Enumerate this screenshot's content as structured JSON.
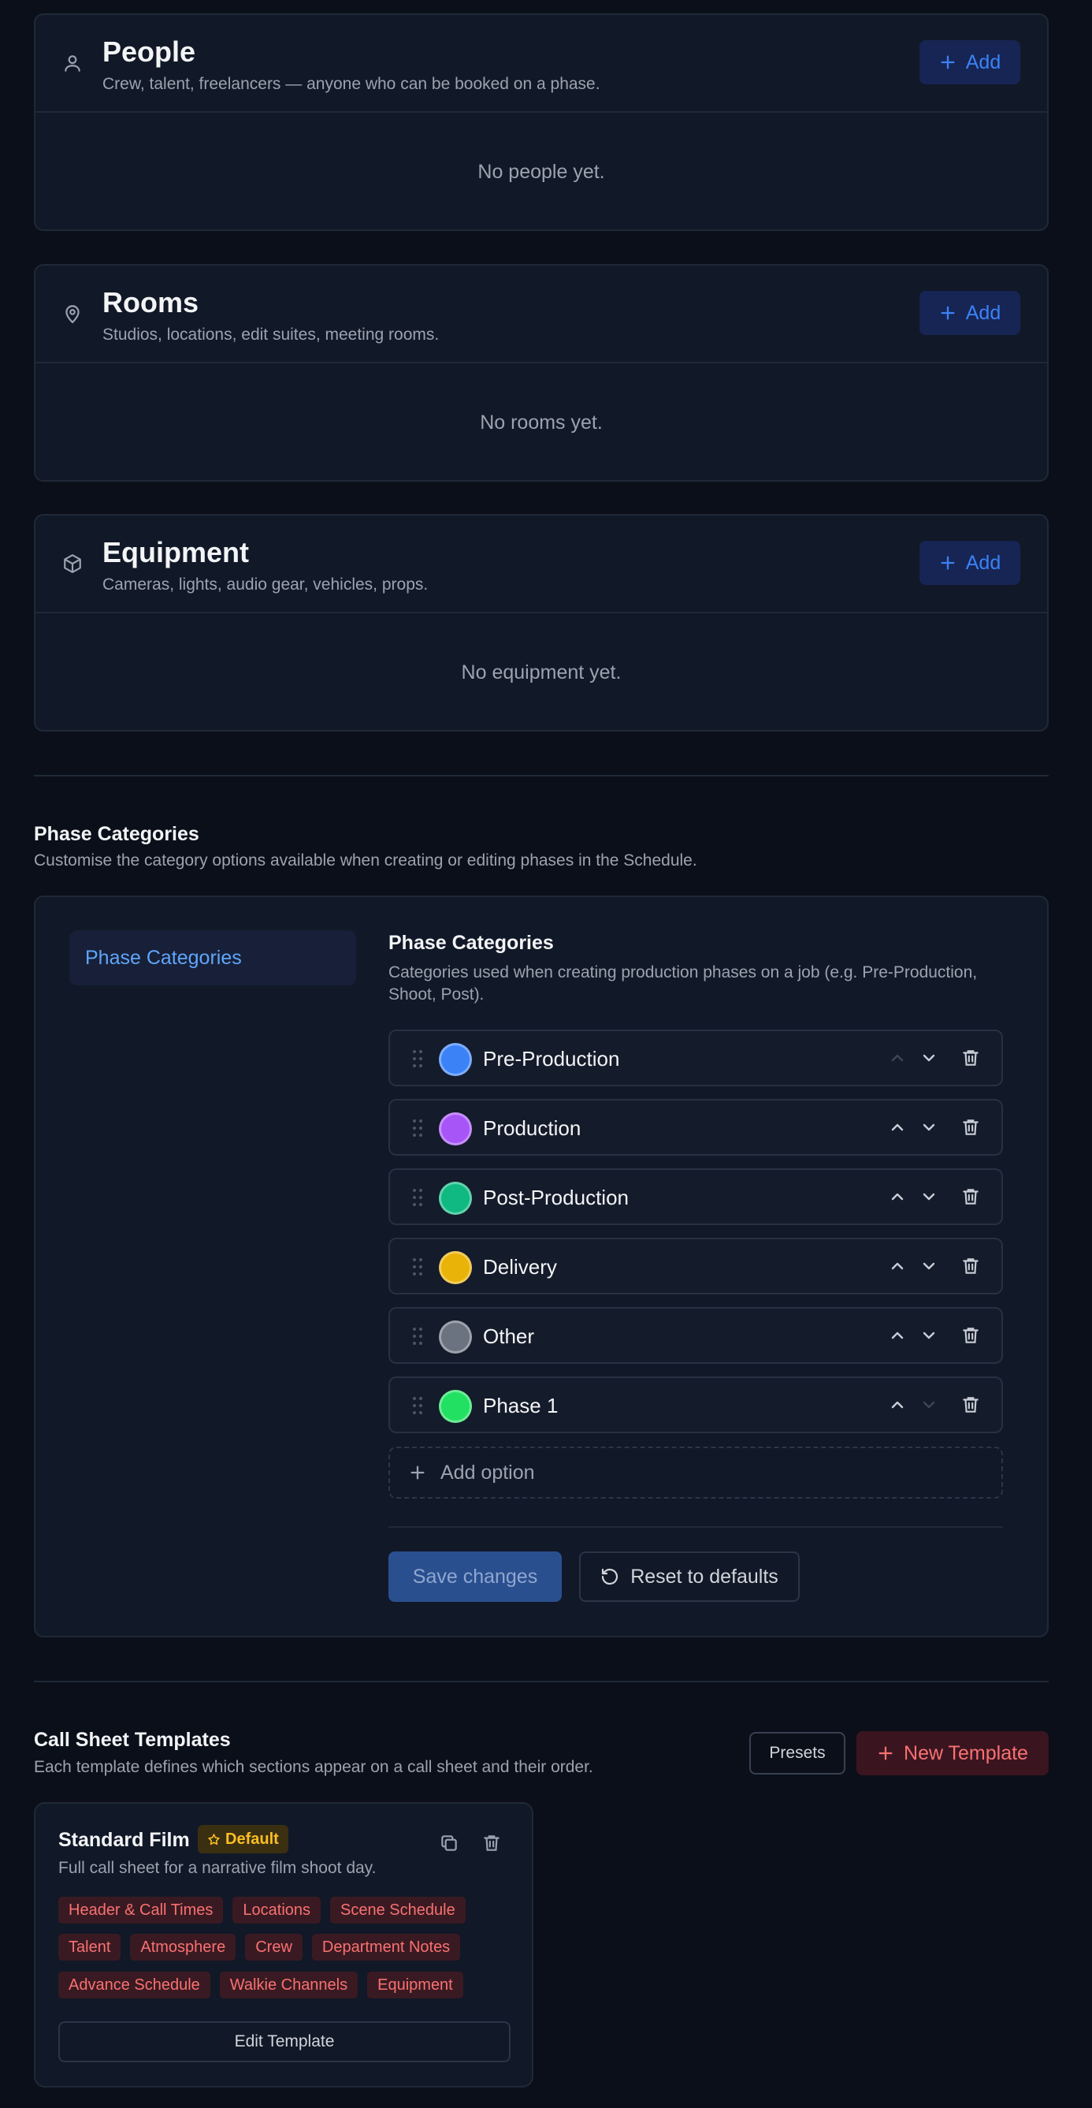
{
  "resources": [
    {
      "title": "People",
      "subtitle": "Crew, talent, freelancers — anyone who can be booked on a phase.",
      "add_label": "Add",
      "empty": "No people yet.",
      "icon": "user-icon"
    },
    {
      "title": "Rooms",
      "subtitle": "Studios, locations, edit suites, meeting rooms.",
      "add_label": "Add",
      "empty": "No rooms yet.",
      "icon": "map-pin-icon"
    },
    {
      "title": "Equipment",
      "subtitle": "Cameras, lights, audio gear, vehicles, props.",
      "add_label": "Add",
      "empty": "No equipment yet.",
      "icon": "box-icon"
    }
  ],
  "phase_section": {
    "title": "Phase Categories",
    "subtitle": "Customise the category options available when creating or editing phases in the Schedule.",
    "tab_label": "Phase Categories",
    "panel_title": "Phase Categories",
    "panel_subtitle": "Categories used when creating production phases on a job (e.g. Pre-Production, Shoot, Post).",
    "options": [
      {
        "label": "Pre-Production",
        "color": "#3b82f6"
      },
      {
        "label": "Production",
        "color": "#a855f7"
      },
      {
        "label": "Post-Production",
        "color": "#10b981"
      },
      {
        "label": "Delivery",
        "color": "#eab308"
      },
      {
        "label": "Other",
        "color": "#6b7280"
      },
      {
        "label": "Phase 1",
        "color": "#22e061"
      }
    ],
    "add_option_label": "Add option",
    "save_label": "Save changes",
    "reset_label": "Reset to defaults"
  },
  "templates_section": {
    "title": "Call Sheet Templates",
    "subtitle": "Each template defines which sections appear on a call sheet and their order.",
    "presets_label": "Presets",
    "new_label": "New Template",
    "template": {
      "name": "Standard Film",
      "badge": "Default",
      "description": "Full call sheet for a narrative film shoot day.",
      "sections": [
        "Header & Call Times",
        "Locations",
        "Scene Schedule",
        "Talent",
        "Atmosphere",
        "Crew",
        "Department Notes",
        "Advance Schedule",
        "Walkie Channels",
        "Equipment"
      ],
      "edit_label": "Edit Template"
    }
  },
  "colors": {
    "accent": "#3b82f6",
    "danger": "#f87171",
    "badge": "#fbbf24"
  }
}
